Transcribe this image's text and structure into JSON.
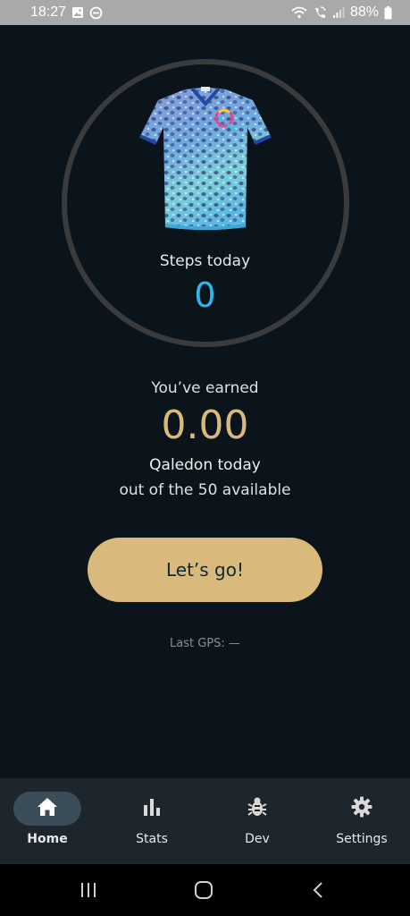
{
  "status_bar": {
    "time": "18:27",
    "battery": "88%",
    "icons_left": [
      "gallery-icon",
      "do-not-disturb-icon"
    ],
    "icons_right": [
      "wifi-icon",
      "wifi-calling-icon",
      "signal-icon",
      "battery-icon"
    ]
  },
  "steps": {
    "label": "Steps today",
    "value": "0"
  },
  "earnings": {
    "label": "You’ve earned",
    "value": "0.00",
    "unit_text": "Qaledon today",
    "available_text": "out of the 50 available"
  },
  "cta": {
    "label": "Let’s go!"
  },
  "gps": {
    "text": "Last GPS: —"
  },
  "bottom_nav": {
    "items": [
      {
        "label": "Home",
        "icon": "home-icon",
        "active": true
      },
      {
        "label": "Stats",
        "icon": "bar-chart-icon",
        "active": false
      },
      {
        "label": "Dev",
        "icon": "bug-icon",
        "active": false
      },
      {
        "label": "Settings",
        "icon": "gear-icon",
        "active": false
      }
    ]
  },
  "colors": {
    "background": "#0c141b",
    "accent_gold": "#d9b97c",
    "steps_blue": "#2fb7ec",
    "ring": "#3a3b3d",
    "nav_bg": "#1d252d",
    "nav_active_pill": "#3c4d5a"
  }
}
